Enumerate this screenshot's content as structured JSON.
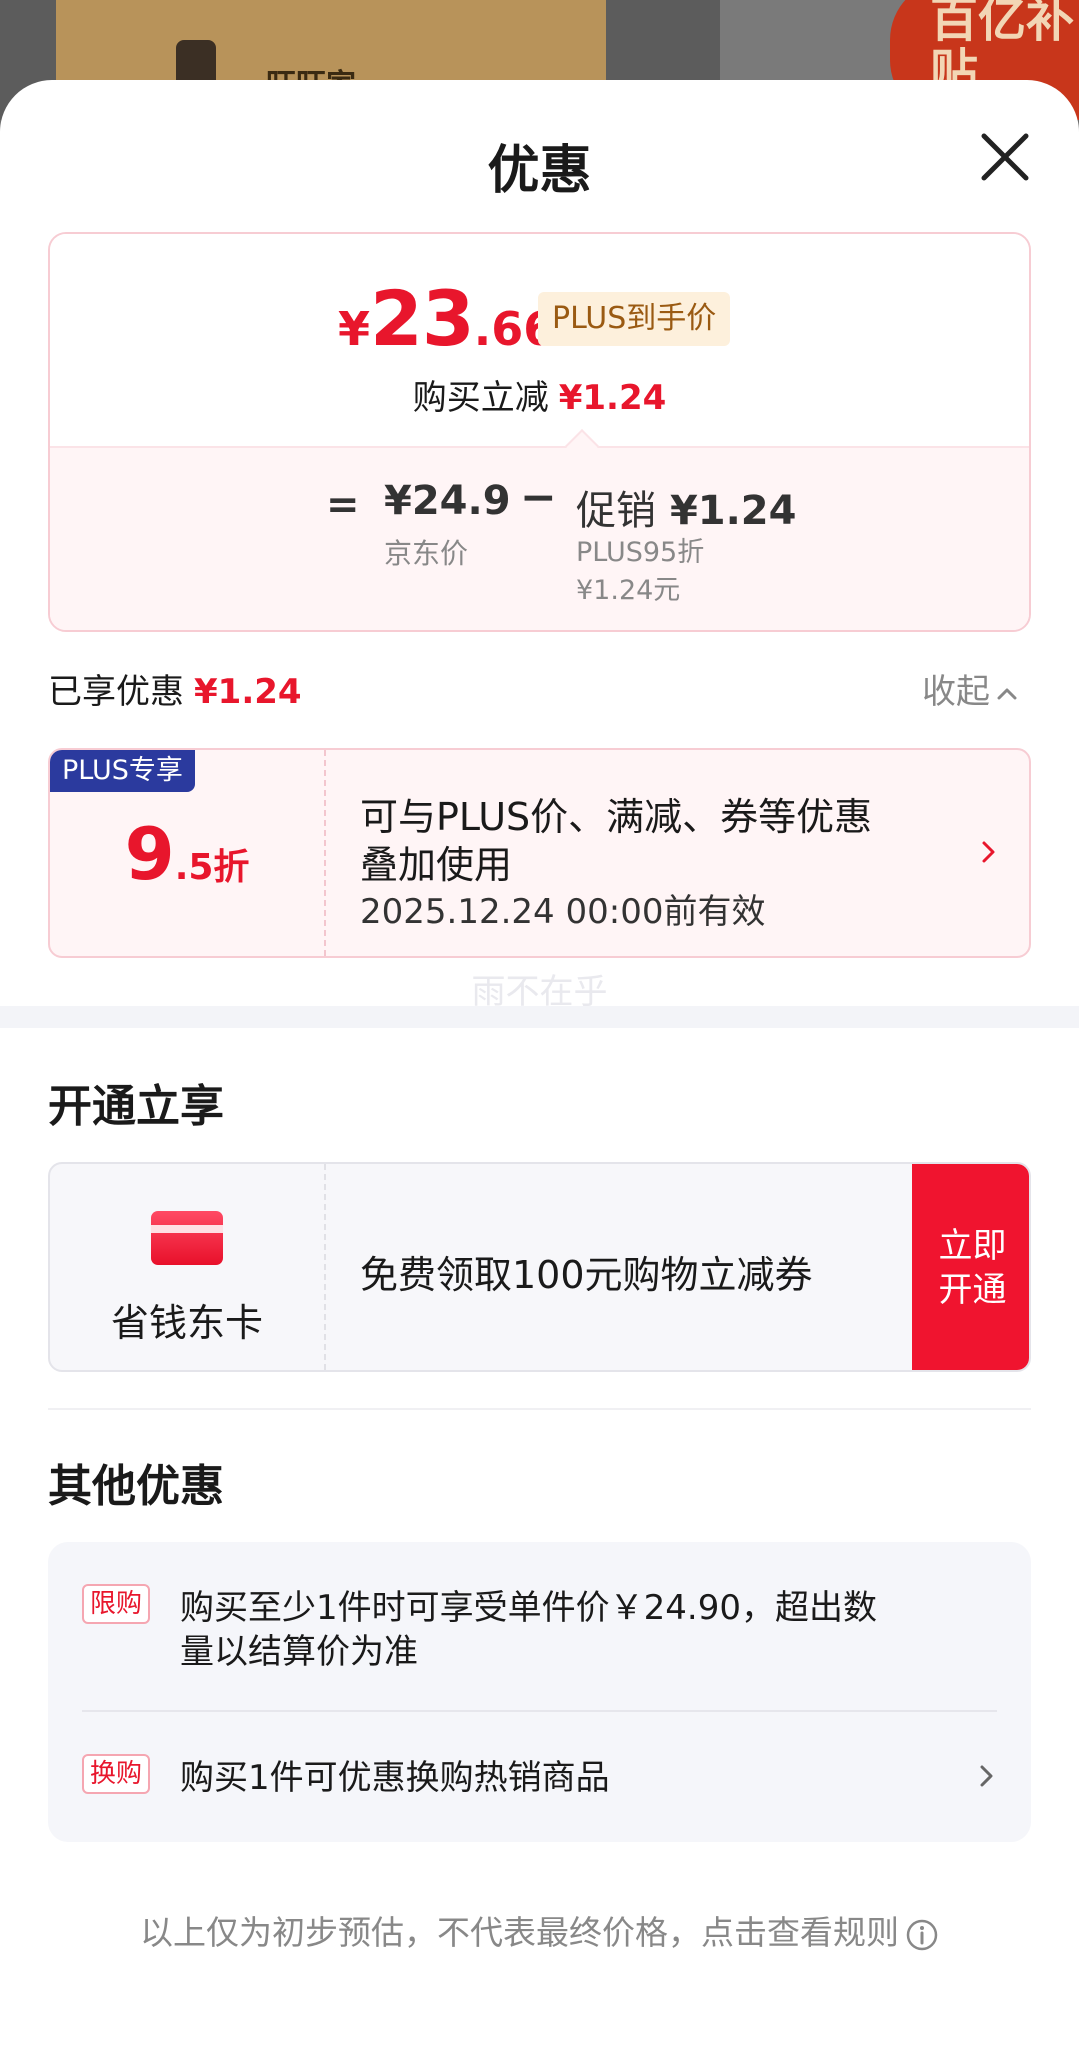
{
  "background": {
    "box_label": "旺旺家",
    "badge_text": "百亿补贴"
  },
  "sheet": {
    "title": "优惠",
    "close_icon": "close-icon"
  },
  "price_card": {
    "currency": "¥",
    "final_int": "23",
    "final_dec": ".66",
    "final_tag": "PLUS到手价",
    "reduce_label": "购买立减",
    "reduce_amount": "¥1.24",
    "equals": "=",
    "jd_price": "¥24.9",
    "jd_label": "京东价",
    "minus": "−",
    "promo_label": "促销",
    "promo_amount": "¥1.24",
    "promo_sub1": "PLUS95折",
    "promo_sub2": "¥1.24元"
  },
  "enjoyed": {
    "label": "已享优惠",
    "amount": "¥1.24",
    "collapse_label": "收起"
  },
  "plus_coupon": {
    "badge": "PLUS专享",
    "discount_big": "9",
    "discount_small": ".5折",
    "text_line1": "可与PLUS价、满减、券等优惠",
    "text_line2": "叠加使用",
    "valid_until": "2025.12.24 00:00前有效"
  },
  "watermark": "雨不在乎",
  "open_section": {
    "title": "开通立享",
    "card_name": "省钱东卡",
    "offer_text": "免费领取100元购物立减券",
    "button_line1": "立即",
    "button_line2": "开通",
    "accent_color": "#f0142f"
  },
  "other_section": {
    "title": "其他优惠",
    "items": [
      {
        "tag": "限购",
        "text_line1": "购买至少1件时可享受单件价￥24.90，超出数",
        "text_line2": "量以结算价为准"
      },
      {
        "tag": "换购",
        "text_line1": "购买1件可优惠换购热销商品"
      }
    ]
  },
  "footer": {
    "note": "以上仅为初步预估，不代表最终价格，点击查看规则"
  },
  "colors": {
    "price_red": "#e8162c",
    "plus_blue": "#2b3a9e",
    "plus_tag_bg": "#fdf0dc"
  }
}
